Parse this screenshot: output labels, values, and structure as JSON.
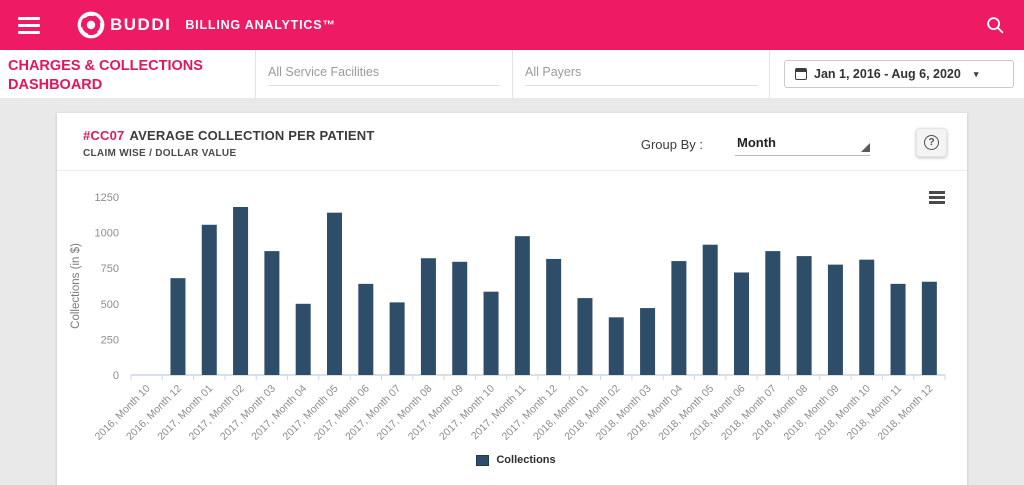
{
  "topbar": {
    "brand": "BUDDI",
    "product": "BILLING ANALYTICS™"
  },
  "filterbar": {
    "dashboard_title": "CHARGES & COLLECTIONS DASHBOARD",
    "facilities_placeholder": "All Service Facilities",
    "payers_placeholder": "All Payers",
    "date_range": "Jan 1, 2016 - Aug 6, 2020",
    "date_caret_glyph": "▾"
  },
  "card": {
    "code": "#CC07",
    "title": "AVERAGE COLLECTION PER PATIENT",
    "subtitle": "CLAIM WISE / DOLLAR VALUE",
    "group_by_label": "Group By :",
    "group_by_value": "Month",
    "help_glyph": "?"
  },
  "colors": {
    "accent_pink": "#ee1a64",
    "bar_fill": "#2e4d68",
    "axis_line": "#ccd7e2",
    "tick_text": "#8d8d8d"
  },
  "chart_data": {
    "type": "bar",
    "title": "AVERAGE COLLECTION PER PATIENT",
    "categories": [
      "2016, Month 10",
      "2016, Month 12",
      "2017, Month 01",
      "2017, Month 02",
      "2017, Month 03",
      "2017, Month 04",
      "2017, Month 05",
      "2017, Month 06",
      "2017, Month 07",
      "2017, Month 08",
      "2017, Month 09",
      "2017, Month 10",
      "2017, Month 11",
      "2017, Month 12",
      "2018, Month 01",
      "2018, Month 02",
      "2018, Month 03",
      "2018, Month 04",
      "2018, Month 05",
      "2018, Month 06",
      "2018, Month 07",
      "2018, Month 08",
      "2018, Month 09",
      "2018, Month 10",
      "2018, Month 11",
      "2018, Month 12"
    ],
    "values": [
      0,
      680,
      1055,
      1180,
      870,
      500,
      1140,
      640,
      510,
      820,
      795,
      585,
      975,
      815,
      540,
      405,
      470,
      800,
      915,
      720,
      870,
      835,
      775,
      810,
      640,
      655
    ],
    "xlabel": "",
    "ylabel": "Collections (in $)",
    "ylim": [
      0,
      1250
    ],
    "ytick_step": 250,
    "grid": false,
    "legend": [
      "Collections"
    ],
    "legend_position": "bottom-center"
  }
}
